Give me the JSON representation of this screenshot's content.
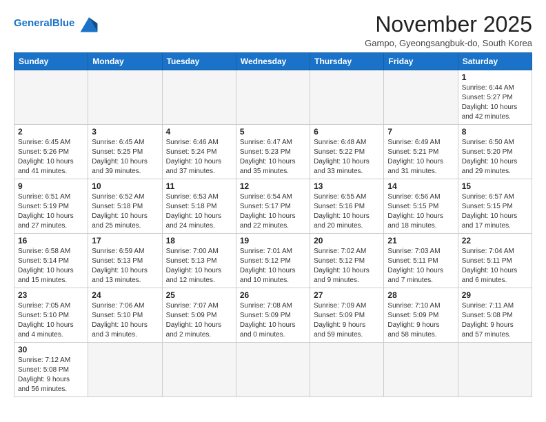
{
  "header": {
    "logo_general": "General",
    "logo_blue": "Blue",
    "month_title": "November 2025",
    "location": "Gampo, Gyeongsangbuk-do, South Korea"
  },
  "weekdays": [
    "Sunday",
    "Monday",
    "Tuesday",
    "Wednesday",
    "Thursday",
    "Friday",
    "Saturday"
  ],
  "weeks": [
    [
      {
        "day": "",
        "info": ""
      },
      {
        "day": "",
        "info": ""
      },
      {
        "day": "",
        "info": ""
      },
      {
        "day": "",
        "info": ""
      },
      {
        "day": "",
        "info": ""
      },
      {
        "day": "",
        "info": ""
      },
      {
        "day": "1",
        "info": "Sunrise: 6:44 AM\nSunset: 5:27 PM\nDaylight: 10 hours\nand 42 minutes."
      }
    ],
    [
      {
        "day": "2",
        "info": "Sunrise: 6:45 AM\nSunset: 5:26 PM\nDaylight: 10 hours\nand 41 minutes."
      },
      {
        "day": "3",
        "info": "Sunrise: 6:45 AM\nSunset: 5:25 PM\nDaylight: 10 hours\nand 39 minutes."
      },
      {
        "day": "4",
        "info": "Sunrise: 6:46 AM\nSunset: 5:24 PM\nDaylight: 10 hours\nand 37 minutes."
      },
      {
        "day": "5",
        "info": "Sunrise: 6:47 AM\nSunset: 5:23 PM\nDaylight: 10 hours\nand 35 minutes."
      },
      {
        "day": "6",
        "info": "Sunrise: 6:48 AM\nSunset: 5:22 PM\nDaylight: 10 hours\nand 33 minutes."
      },
      {
        "day": "7",
        "info": "Sunrise: 6:49 AM\nSunset: 5:21 PM\nDaylight: 10 hours\nand 31 minutes."
      },
      {
        "day": "8",
        "info": "Sunrise: 6:50 AM\nSunset: 5:20 PM\nDaylight: 10 hours\nand 29 minutes."
      }
    ],
    [
      {
        "day": "9",
        "info": "Sunrise: 6:51 AM\nSunset: 5:19 PM\nDaylight: 10 hours\nand 27 minutes."
      },
      {
        "day": "10",
        "info": "Sunrise: 6:52 AM\nSunset: 5:18 PM\nDaylight: 10 hours\nand 25 minutes."
      },
      {
        "day": "11",
        "info": "Sunrise: 6:53 AM\nSunset: 5:18 PM\nDaylight: 10 hours\nand 24 minutes."
      },
      {
        "day": "12",
        "info": "Sunrise: 6:54 AM\nSunset: 5:17 PM\nDaylight: 10 hours\nand 22 minutes."
      },
      {
        "day": "13",
        "info": "Sunrise: 6:55 AM\nSunset: 5:16 PM\nDaylight: 10 hours\nand 20 minutes."
      },
      {
        "day": "14",
        "info": "Sunrise: 6:56 AM\nSunset: 5:15 PM\nDaylight: 10 hours\nand 18 minutes."
      },
      {
        "day": "15",
        "info": "Sunrise: 6:57 AM\nSunset: 5:15 PM\nDaylight: 10 hours\nand 17 minutes."
      }
    ],
    [
      {
        "day": "16",
        "info": "Sunrise: 6:58 AM\nSunset: 5:14 PM\nDaylight: 10 hours\nand 15 minutes."
      },
      {
        "day": "17",
        "info": "Sunrise: 6:59 AM\nSunset: 5:13 PM\nDaylight: 10 hours\nand 13 minutes."
      },
      {
        "day": "18",
        "info": "Sunrise: 7:00 AM\nSunset: 5:13 PM\nDaylight: 10 hours\nand 12 minutes."
      },
      {
        "day": "19",
        "info": "Sunrise: 7:01 AM\nSunset: 5:12 PM\nDaylight: 10 hours\nand 10 minutes."
      },
      {
        "day": "20",
        "info": "Sunrise: 7:02 AM\nSunset: 5:12 PM\nDaylight: 10 hours\nand 9 minutes."
      },
      {
        "day": "21",
        "info": "Sunrise: 7:03 AM\nSunset: 5:11 PM\nDaylight: 10 hours\nand 7 minutes."
      },
      {
        "day": "22",
        "info": "Sunrise: 7:04 AM\nSunset: 5:11 PM\nDaylight: 10 hours\nand 6 minutes."
      }
    ],
    [
      {
        "day": "23",
        "info": "Sunrise: 7:05 AM\nSunset: 5:10 PM\nDaylight: 10 hours\nand 4 minutes."
      },
      {
        "day": "24",
        "info": "Sunrise: 7:06 AM\nSunset: 5:10 PM\nDaylight: 10 hours\nand 3 minutes."
      },
      {
        "day": "25",
        "info": "Sunrise: 7:07 AM\nSunset: 5:09 PM\nDaylight: 10 hours\nand 2 minutes."
      },
      {
        "day": "26",
        "info": "Sunrise: 7:08 AM\nSunset: 5:09 PM\nDaylight: 10 hours\nand 0 minutes."
      },
      {
        "day": "27",
        "info": "Sunrise: 7:09 AM\nSunset: 5:09 PM\nDaylight: 9 hours\nand 59 minutes."
      },
      {
        "day": "28",
        "info": "Sunrise: 7:10 AM\nSunset: 5:09 PM\nDaylight: 9 hours\nand 58 minutes."
      },
      {
        "day": "29",
        "info": "Sunrise: 7:11 AM\nSunset: 5:08 PM\nDaylight: 9 hours\nand 57 minutes."
      }
    ],
    [
      {
        "day": "30",
        "info": "Sunrise: 7:12 AM\nSunset: 5:08 PM\nDaylight: 9 hours\nand 56 minutes."
      },
      {
        "day": "",
        "info": ""
      },
      {
        "day": "",
        "info": ""
      },
      {
        "day": "",
        "info": ""
      },
      {
        "day": "",
        "info": ""
      },
      {
        "day": "",
        "info": ""
      },
      {
        "day": "",
        "info": ""
      }
    ]
  ]
}
